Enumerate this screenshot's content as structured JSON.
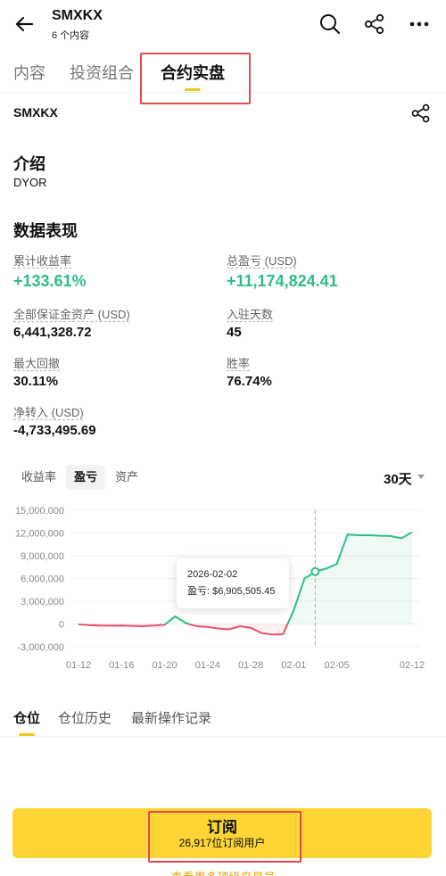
{
  "header": {
    "title": "SMXKX",
    "subtitle": "6 个内容"
  },
  "tabs": [
    {
      "label": "内容",
      "active": false
    },
    {
      "label": "投资组合",
      "active": false
    },
    {
      "label": "合约实盘",
      "active": true
    }
  ],
  "account": {
    "name": "SMXKX"
  },
  "intro": {
    "title": "介绍",
    "text": "DYOR"
  },
  "performance": {
    "title": "数据表现",
    "cumulative_return_label": "累计收益率",
    "cumulative_return_value": "+133.61%",
    "total_pnl_label": "总盈亏 (USD)",
    "total_pnl_value": "+11,174,824.41",
    "margin_assets_label": "全部保证金资产 (USD)",
    "margin_assets_value": "6,441,328.72",
    "days_label": "入驻天数",
    "days_value": "45",
    "max_drawdown_label": "最大回撤",
    "max_drawdown_value": "30.11%",
    "win_rate_label": "胜率",
    "win_rate_value": "76.74%",
    "net_inflow_label": "净转入 (USD)",
    "net_inflow_value": "-4,733,495.69"
  },
  "chart_tabs": [
    {
      "label": "收益率",
      "active": false
    },
    {
      "label": "盈亏",
      "active": true
    },
    {
      "label": "资产",
      "active": false
    }
  ],
  "range_label": "30天",
  "tooltip": {
    "date": "2026-02-02",
    "value_label": "盈亏: $6,905,505.45"
  },
  "colors": {
    "positive": "#2ebd85",
    "negative": "#e8506d",
    "accent": "#fcd535"
  },
  "chart_data": {
    "type": "line",
    "ylim": [
      -3000000,
      15000000
    ],
    "y_ticks": [
      15000000,
      12000000,
      9000000,
      6000000,
      3000000,
      0,
      -3000000
    ],
    "y_tick_labels": [
      "15,000,000",
      "12,000,000",
      "9,000,000",
      "6,000,000",
      "3,000,000",
      "0",
      "-3,000,000"
    ],
    "x_tick_labels": [
      "01-12",
      "01-16",
      "01-20",
      "01-24",
      "01-28",
      "02-01",
      "02-05",
      "02-12"
    ],
    "x_tick_positions": [
      0,
      4,
      8,
      12,
      16,
      20,
      24,
      31
    ],
    "x": [
      0,
      1,
      2,
      3,
      4,
      5,
      6,
      7,
      8,
      9,
      10,
      11,
      12,
      13,
      14,
      15,
      16,
      17,
      18,
      19,
      20,
      21,
      22,
      23,
      24,
      25,
      26,
      27,
      28,
      29,
      30,
      31
    ],
    "values": [
      -50000,
      -150000,
      -200000,
      -220000,
      -200000,
      -250000,
      -300000,
      -200000,
      -100000,
      1000000,
      100000,
      -300000,
      -400000,
      -600000,
      -700000,
      -300000,
      -500000,
      -1200000,
      -1400000,
      -1350000,
      1800000,
      6000000,
      6905505,
      7300000,
      7900000,
      11800000,
      11700000,
      11700000,
      11650000,
      11600000,
      11300000,
      12100000
    ],
    "highlight_index": 22
  },
  "position_tabs": [
    {
      "label": "仓位",
      "active": true
    },
    {
      "label": "仓位历史",
      "active": false
    },
    {
      "label": "最新操作记录",
      "active": false
    }
  ],
  "subscribe": {
    "title": "订阅",
    "count": "26,917位订阅用户"
  },
  "bottom_link": "查看更多顶级交易员"
}
